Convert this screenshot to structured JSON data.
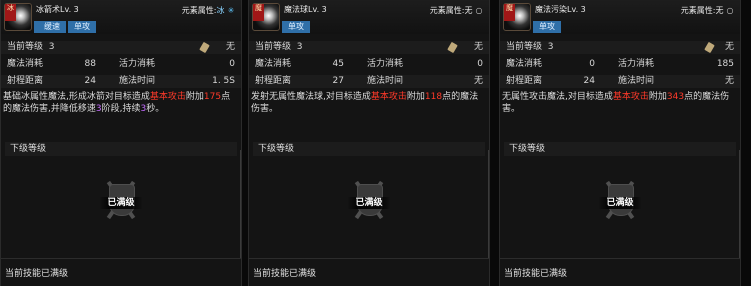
{
  "panels": [
    {
      "badge": "冰",
      "name": "冰箭术Lv. 3",
      "element_label": "元素属性:",
      "element_value": "冰",
      "element_icon": "snowflake-icon",
      "tags": [
        "缓速",
        "单攻"
      ],
      "current_level_label": "当前等级",
      "current_level": "3",
      "scroll_value": "无",
      "mp_label": "魔法消耗",
      "mp": "88",
      "vit_label": "活力消耗",
      "vit": "0",
      "range_label": "射程距离",
      "range": "24",
      "cast_label": "施法时间",
      "cast": "1. 5S",
      "desc_a": "基础冰属性魔法,形成冰箭对目标造成",
      "desc_b": "基本攻击",
      "desc_c": "附加",
      "desc_d": "175",
      "desc_e": "点的魔法伤害,并降低移速",
      "desc_f": "3",
      "desc_g": "阶段,持续",
      "desc_h": "3",
      "desc_i": "秒。",
      "next_level_label": "下级等级",
      "maxed_label": "已满级",
      "footer": "当前技能已满级"
    },
    {
      "badge": "魔",
      "name": "魔法球Lv. 3",
      "element_label": "元素属性:",
      "element_value": "无",
      "element_icon": "ring-icon",
      "tags": [
        "单攻"
      ],
      "current_level_label": "当前等级",
      "current_level": "3",
      "scroll_value": "无",
      "mp_label": "魔法消耗",
      "mp": "45",
      "vit_label": "活力消耗",
      "vit": "0",
      "range_label": "射程距离",
      "range": "27",
      "cast_label": "施法时间",
      "cast": "无",
      "desc_a": "发射无属性魔法球,对目标造成",
      "desc_b": "基本攻击",
      "desc_c": "附加",
      "desc_d": "118",
      "desc_e": "点的魔法伤害。",
      "next_level_label": "下级等级",
      "maxed_label": "已满级",
      "footer": "当前技能已满级"
    },
    {
      "badge": "魔",
      "name": "魔法污染Lv. 3",
      "element_label": "元素属性:",
      "element_value": "无",
      "element_icon": "ring-icon",
      "tags": [
        "单攻"
      ],
      "current_level_label": "当前等级",
      "current_level": "3",
      "scroll_value": "无",
      "mp_label": "魔法消耗",
      "mp": "0",
      "vit_label": "活力消耗",
      "vit": "185",
      "range_label": "射程距离",
      "range": "24",
      "cast_label": "施法时间",
      "cast": "无",
      "desc_a": "无属性攻击魔法,对目标造成",
      "desc_b": "基本攻击",
      "desc_c": "附加",
      "desc_d": "343",
      "desc_e": "点的魔法伤害。",
      "next_level_label": "下级等级",
      "maxed_label": "已满级",
      "footer": "当前技能已满级"
    }
  ]
}
